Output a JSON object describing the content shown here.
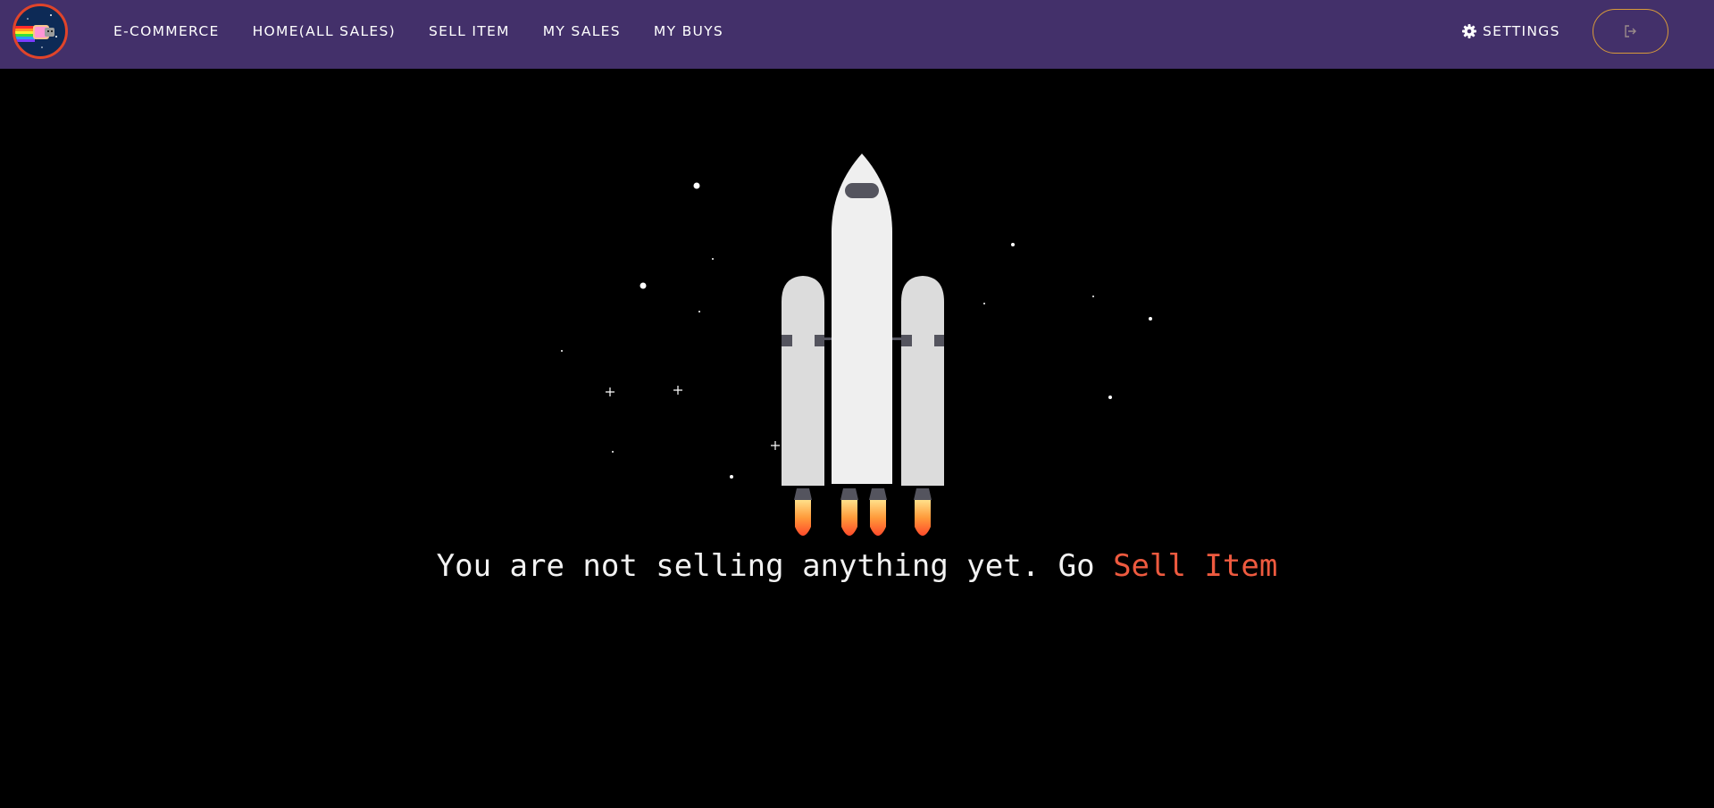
{
  "nav": {
    "logo_icon": "nyan-cat-logo-icon",
    "links": [
      {
        "label": "E-COMMERCE"
      },
      {
        "label": "HOME(ALL SALES)"
      },
      {
        "label": "SELL ITEM"
      },
      {
        "label": "MY SALES"
      },
      {
        "label": "MY BUYS"
      }
    ],
    "settings_label": "SETTINGS",
    "settings_icon": "gear-icon",
    "logout_icon": "sign-out-icon"
  },
  "main": {
    "message_text": "You are not selling anything yet. Go",
    "message_link": "Sell Item",
    "illustration_icon": "rocket-icon"
  },
  "colors": {
    "navbar": "#43306a",
    "background": "#000000",
    "accent": "#ee5a3f",
    "logout_border": "#d89a3a"
  }
}
